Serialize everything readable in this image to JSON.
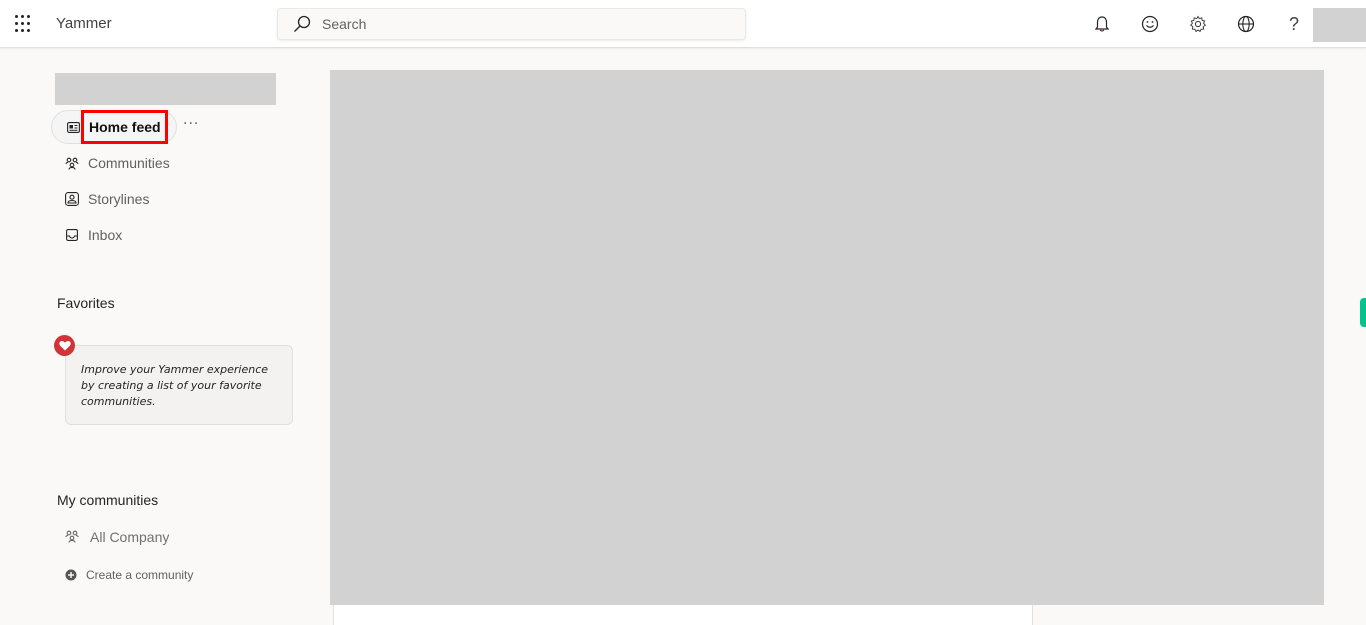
{
  "header": {
    "app_title": "Yammer",
    "search_placeholder": "Search",
    "icons": [
      "waffle-icon",
      "search-icon",
      "bell-icon",
      "smiley-icon",
      "gear-icon",
      "globe-icon",
      "help-icon",
      "avatar"
    ],
    "help_glyph": "?"
  },
  "sidebar": {
    "nav_items": [
      {
        "label": "Home feed",
        "icon": "newspaper-icon",
        "active": true
      },
      {
        "label": "Communities",
        "icon": "people-icon"
      },
      {
        "label": "Storylines",
        "icon": "storyline-icon"
      },
      {
        "label": "Inbox",
        "icon": "inbox-icon"
      }
    ],
    "more_label": "···",
    "favorites": {
      "title": "Favorites",
      "empty_message": "Improve your Yammer experience by creating a list of your favorite communities."
    },
    "my_communities": {
      "title": "My communities",
      "items": [
        {
          "label": "All Company",
          "icon": "people-icon"
        }
      ],
      "create_label": "Create a community"
    }
  },
  "colors": {
    "highlight": "#ff0000",
    "heart": "#d13438",
    "side_tab": "#00c48c",
    "placeholder": "#d2d2d2"
  }
}
